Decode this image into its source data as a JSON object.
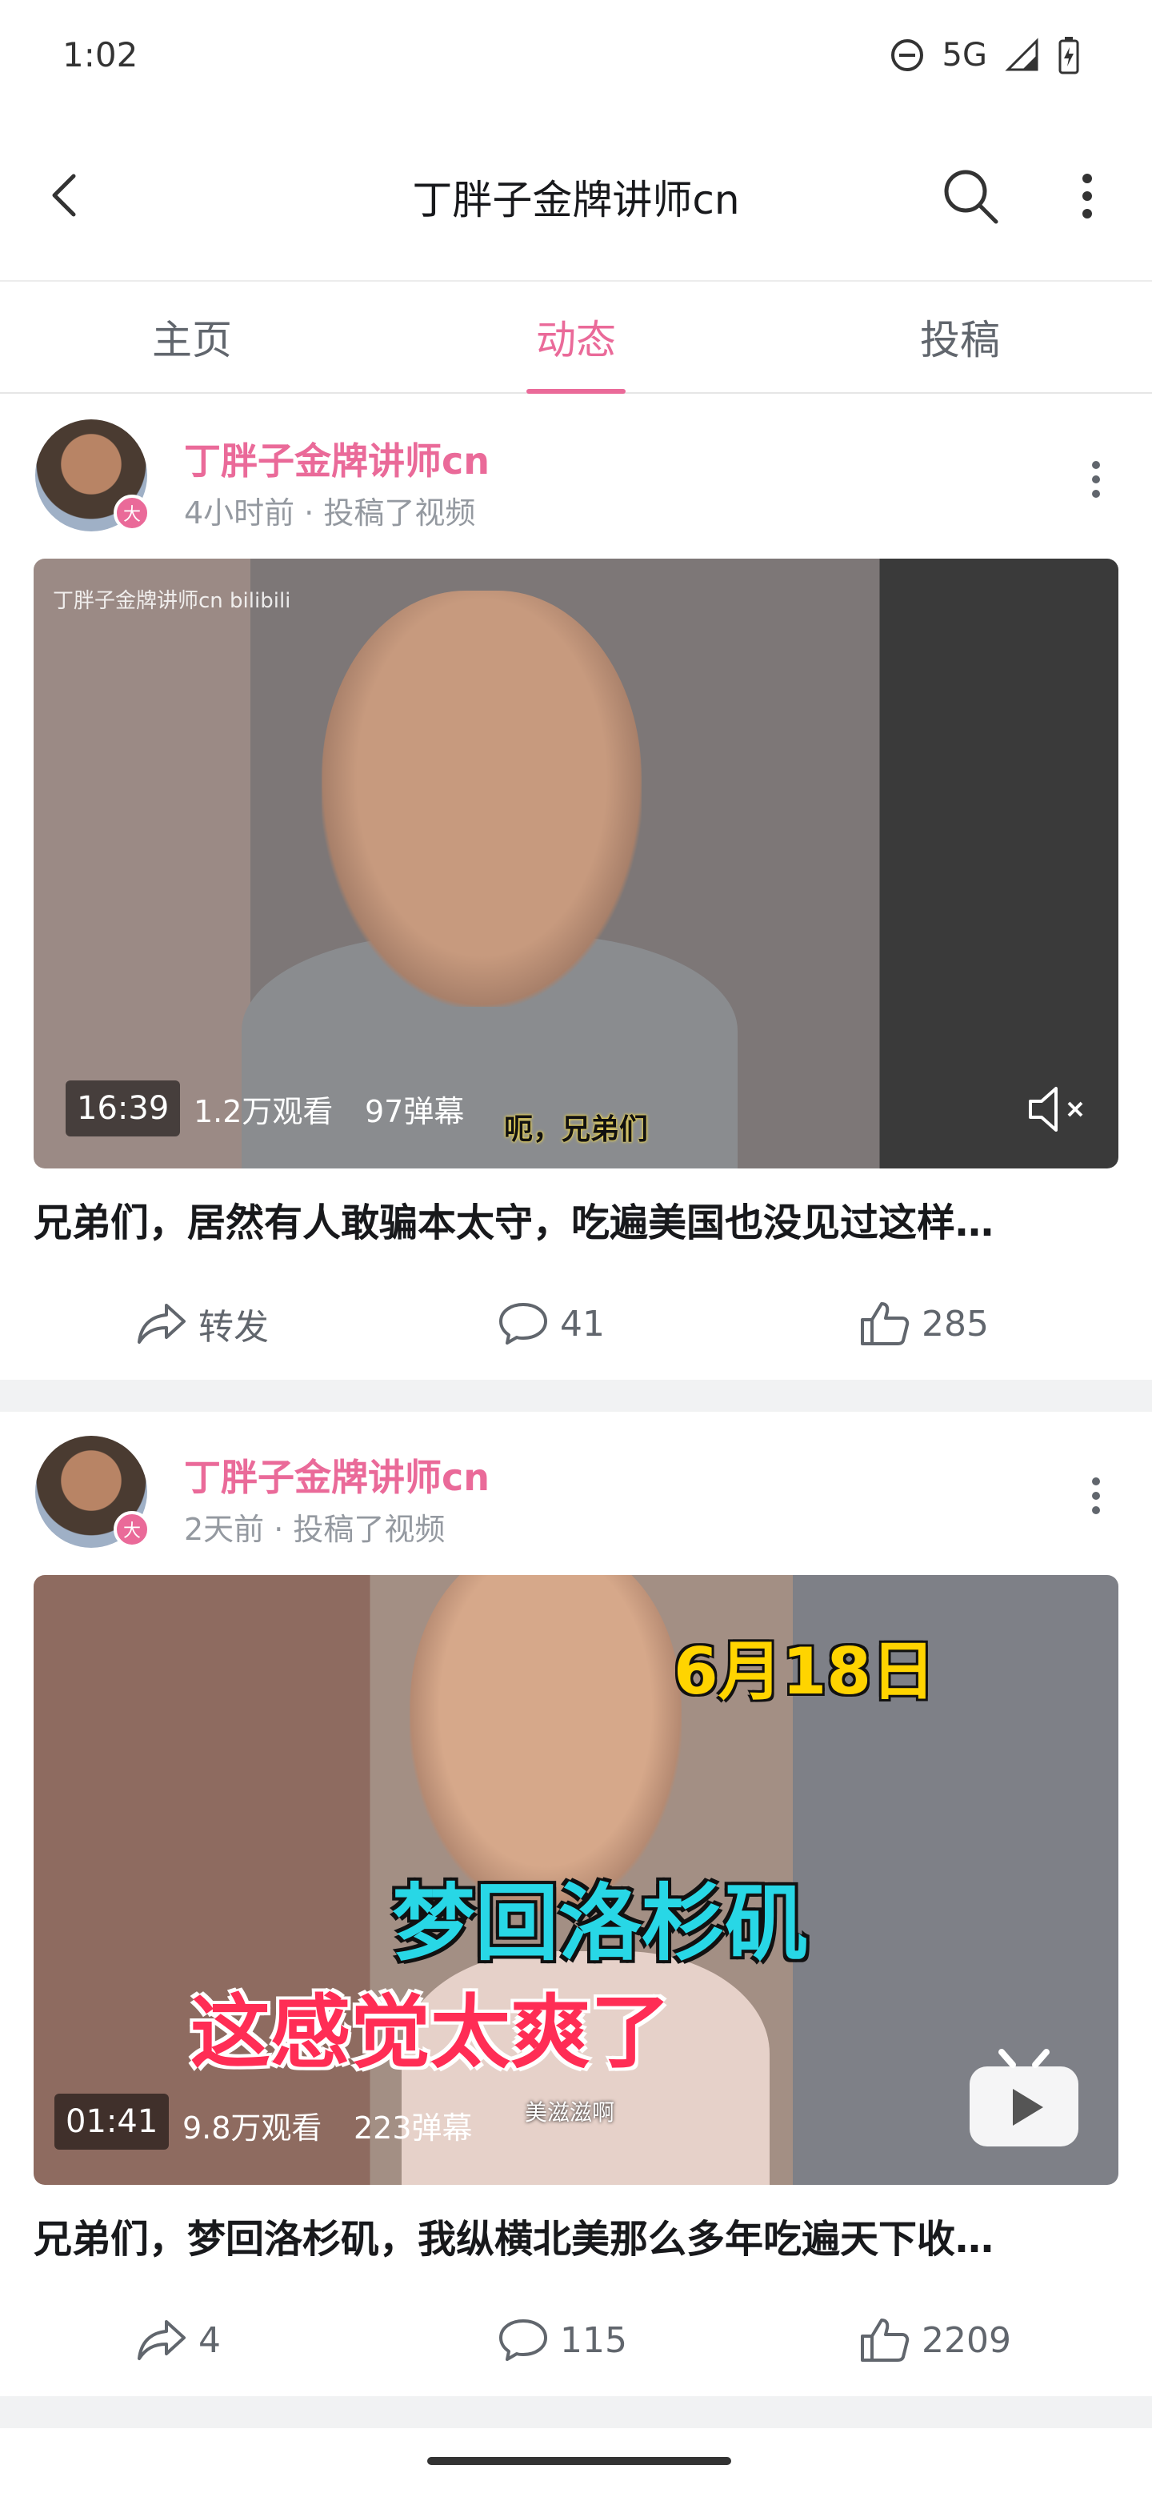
{
  "status_bar": {
    "time": "1:02",
    "network": "5G"
  },
  "header": {
    "title": "丁胖子金牌讲师cn"
  },
  "tabs": [
    {
      "label": "主页",
      "active": false
    },
    {
      "label": "动态",
      "active": true
    },
    {
      "label": "投稿",
      "active": false
    }
  ],
  "accent_color": "#ea6a99",
  "posts": [
    {
      "author": "丁胖子金牌讲师cn",
      "badge": "大",
      "meta": "4小时前 · 投稿了视频",
      "video": {
        "watermark": "丁胖子金牌讲师cn bilibili",
        "subtitle": "呃，兄弟们",
        "duration": "16:39",
        "views": "1.2万观看",
        "danmaku": "97弹幕"
      },
      "title": "兄弟们，居然有人敢骗本太守，吃遍美国也没见过这样…",
      "share_label": "转发",
      "comments": "41",
      "likes": "285"
    },
    {
      "author": "丁胖子金牌讲师cn",
      "badge": "大",
      "meta": "2天前 · 投稿了视频",
      "video": {
        "overlay_date": "6月18日",
        "overlay_line1": "梦回洛杉矶",
        "overlay_line2": "这感觉太爽了",
        "overlay_small": "美滋滋啊",
        "duration": "01:41",
        "views": "9.8万观看",
        "danmaku": "223弹幕"
      },
      "title": "兄弟们，梦回洛杉矶，我纵横北美那么多年吃遍天下收…",
      "share_label": "4",
      "comments": "115",
      "likes": "2209"
    }
  ]
}
